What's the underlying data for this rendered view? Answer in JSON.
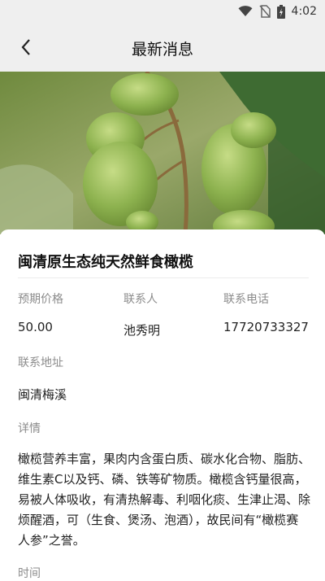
{
  "status_bar": {
    "time": "4:02"
  },
  "app_bar": {
    "title": "最新消息"
  },
  "product": {
    "title": "闽清原生态纯天然鲜食橄榄",
    "price_label": "预期价格",
    "price": "50.00",
    "contact_label": "联系人",
    "contact": "池秀明",
    "phone_label": "联系电话",
    "phone": "17720733327",
    "address_label": "联系地址",
    "address": "闽清梅溪",
    "detail_label": "详情",
    "detail": "橄榄营养丰富，果肉内含蛋白质、碳水化合物、脂肪、维生素C以及钙、磷、铁等矿物质。橄榄含钙量很高，易被人体吸收，有清热解毒、利咽化痰、生津止渴、除烦醒酒，可（生食、煲汤、泡酒），故民间有“橄榄赛人参”之誉。",
    "time_label": "时间"
  }
}
